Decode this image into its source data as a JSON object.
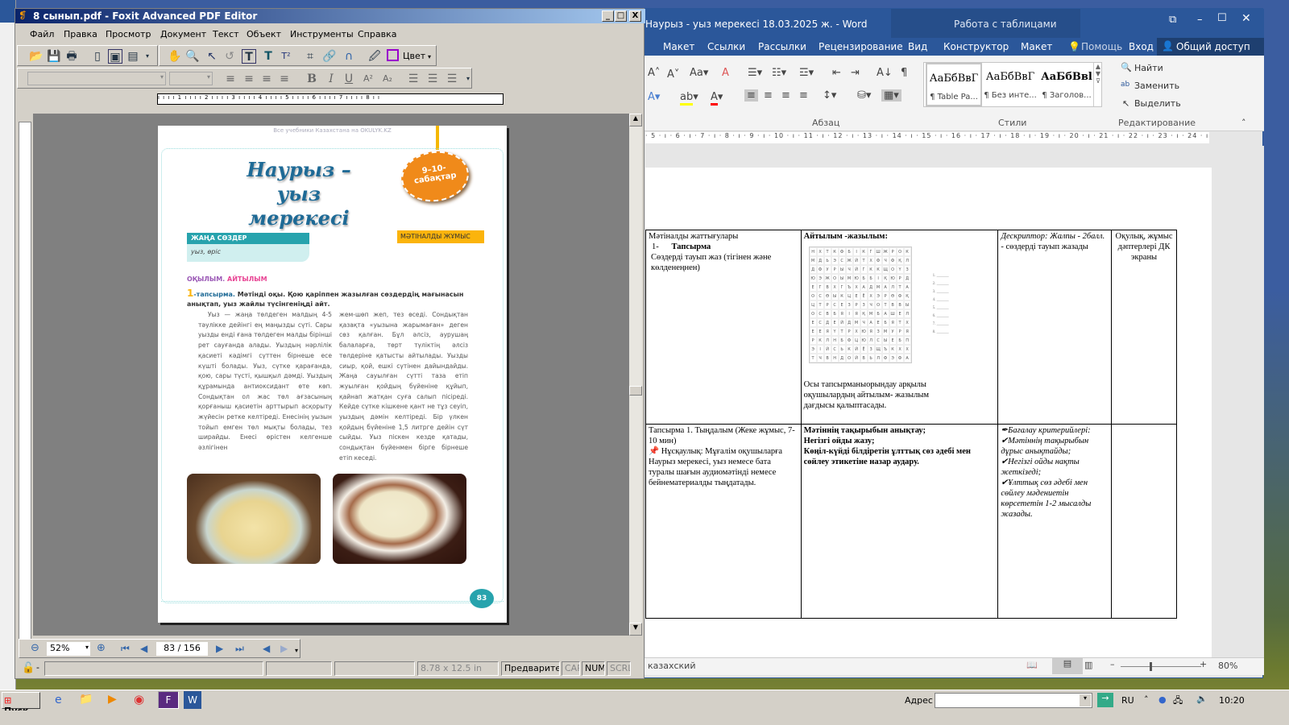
{
  "word": {
    "title": "Наурыз - уыз мерекесі 18.03.2025 ж. - Word",
    "context_tab": "Работа с таблицами",
    "tabs": [
      "Макет",
      "Ссылки",
      "Рассылки",
      "Рецензирование",
      "Вид",
      "Конструктор",
      "Макет"
    ],
    "help": "Помощь",
    "signin": "Вход",
    "share": "Общий доступ",
    "styles": [
      {
        "preview": "АаБбВвГ",
        "name": "¶ Table Pa..."
      },
      {
        "preview": "АаБбВвГ",
        "name": "¶ Без инте..."
      },
      {
        "preview": "АаБбВвl",
        "name": "¶ Заголов..."
      }
    ],
    "groups": {
      "paragraph": "Абзац",
      "styles": "Стили",
      "editing": "Редактирование"
    },
    "editing": {
      "find": "Найти",
      "replace": "Заменить",
      "select": "Выделить"
    },
    "ruler": "· 5 · ı · 6 · ı · 7 · ı · 8 · ı · 9 · ı · 10 · ı · 11 · ı · 12 · ı · 13 · ı · 14 · ı · 15 · ı · 16 · ı · 17 · ı · 18 · ı · 19 · ı · 20 · ı · 21 · ı · 22 · ı · 23 · ı · 24 · ı · 25 · ı · 26 · ı · 27 ·",
    "table": {
      "r1": {
        "c1_line1": "Мәтіналды жаттығулары",
        "c1_num": "1-",
        "c1_task": "Тапсырма",
        "c1_text": "Сөздерді тауып жаз (тігінен және көлденеңнен)",
        "c2_title": "Айтылым -жазылым:",
        "c2_grid": [
          "НХТКФБІКГШЖРОК",
          "МДЬЭСЖЙТХФЧФҚЛ",
          "ДФУРЫЧЙГККЩОҮЗ",
          "ЮЭЖОЫМЮББІҚЮРД",
          "ЕГВХГЪХАДМАЛТА",
          "ОСӨЫКЦЕЁХЭРӨФҚ",
          "ЦТРСЕЗРЗЧОТВВЫ",
          "ОСВБЯІЯҚМБАШЕЛ",
          "ЕСДЕЙДМЧАЕБЯТХ",
          "ЕЕЯҮТРХЮЯЗМУРЯ",
          "РКЛНБФЦЮЛСЫЕБП",
          "ЭІЙСЬКЙЁЗЩЪКХХ",
          "ТЧВНДОЙВЬЛФЭФА"
        ],
        "c2_blanks": [
          "1. ______",
          "2. ______",
          "3. ______",
          "4. ______",
          "5. ______",
          "6. ______",
          "7. ______",
          "8. ______"
        ],
        "c2_text": "Осы тапсырманыорындау арқылы оқушылардың айтылым- жазылым дағдысы қалыптасады.",
        "c3_a": "Дескриптор: Жалпы - 2балл.",
        "c3_b": "- сөздерді тауып жазады",
        "c4": "Оқулық, жұмыс дәптерлері ДК экраны"
      },
      "r2": {
        "c1_a": "Тапсырма 1. Тыңдалым (Жеке жұмыс, 7-10 мин)",
        "c1_b": "Нұсқаулық: Мұғалім оқушыларға Наурыз мерекесі, уыз немесе бата туралы шағын аудиомәтінді немесе бейнематериалды тыңдатады.",
        "c2": [
          "Мәтіннің тақырыбын анықтау;",
          "Негізгі ойды жазу;",
          "Көңіл-күйді білдіретін ұлттық сөз әдебі мен сөйлеу этикетіне назар аудару."
        ],
        "c3": [
          "Бағалау критерийлері:",
          "Мәтіннің тақырыбын дұрыс анықтайды;",
          "Негізгі ойды нақты жеткізеді;",
          "Ұлттық сөз әдебі мен сөйлеу мәдениетін көрсететін 1-2 мысалды жазады."
        ]
      }
    },
    "status": {
      "language": "казахский",
      "zoom": "80%"
    }
  },
  "foxit": {
    "title": "8 сынып.pdf - Foxit Advanced PDF Editor",
    "menu": [
      "Файл",
      "Правка",
      "Просмотр",
      "Документ",
      "Текст",
      "Объект",
      "Инструменты",
      "Справка"
    ],
    "color_label": "Цвет",
    "ruler": "ı ı ı ı 1 ı ı ı ı 2 ı ı ı ı 3 ı ı ı ı 4 ı ı ı ı 5 ı ı ı ı 6 ı ı ı ı 7 ı ı ı ı 8 ı ı",
    "zoom": "52%",
    "page": "83 / 156",
    "page_size": "8.78 x 12.5 in",
    "preview": "Предварител",
    "cap": "CAP",
    "num": "NUM",
    "scrl": "SCRL",
    "lock_dash": "-"
  },
  "pdf": {
    "watermark": "Все учебники Казахстана на OKULYK.KZ",
    "title1": "Наурыз –",
    "title2": "уыз мерекесі",
    "badge": "9–10-сабақтар",
    "new_words_label": "ЖАҢА СӨЗДЕР",
    "new_words": "уыз, өріс",
    "pre_text": "МӘТІНАЛДЫ ЖҰМЫС",
    "section_a": "ОҚЫЛЫМ.",
    "section_b": "АЙТЫЛЫМ",
    "task_num": "1",
    "task_label": "-тапсырма.",
    "task_text": "Мәтінді оқы. Қою қаріппен жазылған сөздердің мағынасын анықтап, уыз жайлы түсінгеніңді айт.",
    "col1": "Уыз — жаңа төлдеген малдың 4-5 тәулікке дейінгі ең маңызды сүті. Сары уызды енді ғана төлдеген малды бірінші рет сауғанда алады. Уыздың нәрлілік қасиеті кәдімгі сүттен бірнеше есе күшті болады. Уыз, сүтке қарағанда, қою, сары түсті, қышқыл дәмді. Уыздың құрамында антиоксидант өте көп. Сондықтан ол жас төл ағзасының қорғаныш қасиетін арттырып асқорыту жүйесін ретке келтіреді. Енесінің уызын тойып емген төл мықты болады, тез ширайды. Енесі өрістен келгенше әзлігінен",
    "col2": "жем-шөп жеп, тез өседі. Сондықтан қазақта «уызына жарымаған» деген сөз қалған. Бұл әлсіз, аурушаң балаларға, төрт түліктің әлсіз төлдеріне қатысты айтылады. Уызды сиыр, қой, ешкі сүтінен дайындайды. Жаңа сауылған сүтті таза етіп жуылған қойдың бүйеніне құйып, қайнап жатқан суға салып пісіреді. Кейде сүтке кішкене қант не тұз сеуіп, уыздың дәмін келтіреді. Бір үлкен қойдың бүйеніне 1,5 литрге дейін сүт сыйды. Уыз піскен кезде қатады, сондықтан бүйенмен бірге бірнеше етіп кеседі.",
    "page_number": "83"
  },
  "taskbar": {
    "start": "Пуск",
    "address_label": "Адрес",
    "lang": "RU",
    "clock": "10:20"
  }
}
